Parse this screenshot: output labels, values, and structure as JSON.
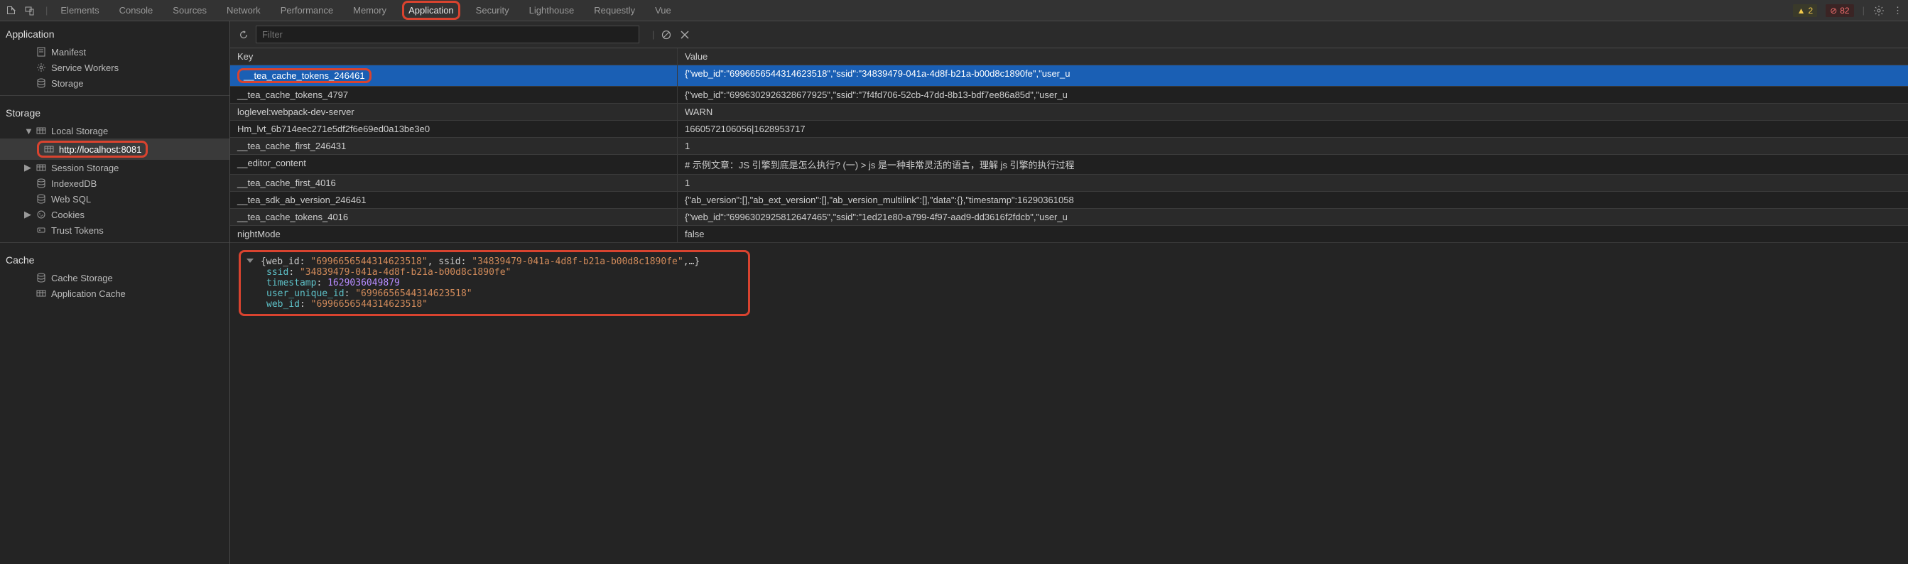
{
  "tabs": {
    "items": [
      "Elements",
      "Console",
      "Sources",
      "Network",
      "Performance",
      "Memory",
      "Application",
      "Security",
      "Lighthouse",
      "Requestly",
      "Vue"
    ],
    "active": "Application"
  },
  "badges": {
    "warn_count": "2",
    "err_count": "82"
  },
  "sidebar": {
    "sections": [
      {
        "title": "Application",
        "items": [
          {
            "label": "Manifest",
            "icon": "manifest-icon"
          },
          {
            "label": "Service Workers",
            "icon": "gear-icon"
          },
          {
            "label": "Storage",
            "icon": "database-icon"
          }
        ]
      },
      {
        "title": "Storage",
        "items": [
          {
            "label": "Local Storage",
            "icon": "grid-icon",
            "expanded": true,
            "children": [
              {
                "label": "http://localhost:8081",
                "icon": "grid-icon",
                "selected": true,
                "highlighted": true
              }
            ]
          },
          {
            "label": "Session Storage",
            "icon": "grid-icon",
            "expandable": true
          },
          {
            "label": "IndexedDB",
            "icon": "database-icon"
          },
          {
            "label": "Web SQL",
            "icon": "database-icon"
          },
          {
            "label": "Cookies",
            "icon": "cookie-icon",
            "expandable": true
          },
          {
            "label": "Trust Tokens",
            "icon": "token-icon"
          }
        ]
      },
      {
        "title": "Cache",
        "items": [
          {
            "label": "Cache Storage",
            "icon": "database-icon"
          },
          {
            "label": "Application Cache",
            "icon": "grid-icon"
          }
        ]
      }
    ]
  },
  "toolbar": {
    "filter_placeholder": "Filter"
  },
  "table": {
    "headers": {
      "key": "Key",
      "value": "Value"
    },
    "rows": [
      {
        "key": "__tea_cache_tokens_246461",
        "value": "{\"web_id\":\"6996656544314623518\",\"ssid\":\"34839479-041a-4d8f-b21a-b00d8c1890fe\",\"user_u",
        "selected": true,
        "key_highlighted": true
      },
      {
        "key": "__tea_cache_tokens_4797",
        "value": "{\"web_id\":\"6996302926328677925\",\"ssid\":\"7f4fd706-52cb-47dd-8b13-bdf7ee86a85d\",\"user_u"
      },
      {
        "key": "loglevel:webpack-dev-server",
        "value": "WARN"
      },
      {
        "key": "Hm_lvt_6b714eec271e5df2f6e69ed0a13be3e0",
        "value": "1660572106056|1628953717"
      },
      {
        "key": "__tea_cache_first_246431",
        "value": "1"
      },
      {
        "key": "__editor_content",
        "value": "# 示例文章：JS 引擎到底是怎么执行? (一) > js 是一种非常灵活的语言，理解 js 引擎的执行过程"
      },
      {
        "key": "__tea_cache_first_4016",
        "value": "1"
      },
      {
        "key": "__tea_sdk_ab_version_246461",
        "value": "{\"ab_version\":[],\"ab_ext_version\":[],\"ab_version_multilink\":[],\"data\":{},\"timestamp\":16290361058"
      },
      {
        "key": "__tea_cache_tokens_4016",
        "value": "{\"web_id\":\"6996302925812647465\",\"ssid\":\"1ed21e80-a799-4f97-aad9-dd3616f2fdcb\",\"user_u"
      },
      {
        "key": "nightMode",
        "value": "false"
      }
    ]
  },
  "detail": {
    "summary_prefix": "{web_id: ",
    "summary_webid": "\"6996656544314623518\"",
    "summary_mid": ", ssid: ",
    "summary_ssid": "\"34839479-041a-4d8f-b21a-b00d8c1890fe\"",
    "summary_suffix": ",…}",
    "fields": [
      {
        "k": "ssid",
        "v": "\"34839479-041a-4d8f-b21a-b00d8c1890fe\"",
        "type": "str"
      },
      {
        "k": "timestamp",
        "v": "1629036049879",
        "type": "num"
      },
      {
        "k": "user_unique_id",
        "v": "\"6996656544314623518\"",
        "type": "str"
      },
      {
        "k": "web_id",
        "v": "\"6996656544314623518\"",
        "type": "str"
      }
    ]
  }
}
